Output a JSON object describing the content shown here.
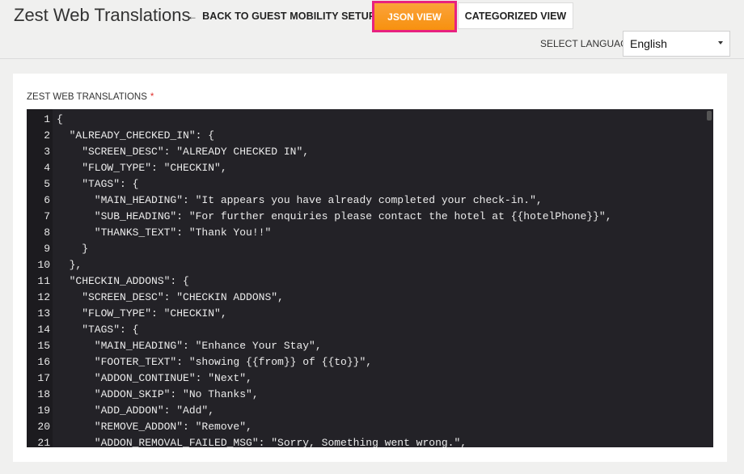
{
  "header": {
    "title": "Zest Web Translations",
    "back_label": "BACK TO GUEST MOBILITY SETUP",
    "json_view_label": "JSON VIEW",
    "categorized_view_label": "CATEGORIZED VIEW",
    "language_label": "SELECT LANGUAGE",
    "language_value": "English"
  },
  "form": {
    "field_label": "ZEST WEB TRANSLATIONS",
    "required_marker": "*"
  },
  "editor": {
    "lines": [
      {
        "n": "1",
        "text": "{"
      },
      {
        "n": "2",
        "text": "  \"ALREADY_CHECKED_IN\": {"
      },
      {
        "n": "3",
        "text": "    \"SCREEN_DESC\": \"ALREADY CHECKED IN\","
      },
      {
        "n": "4",
        "text": "    \"FLOW_TYPE\": \"CHECKIN\","
      },
      {
        "n": "5",
        "text": "    \"TAGS\": {"
      },
      {
        "n": "6",
        "text": "      \"MAIN_HEADING\": \"It appears you have already completed your check-in.\","
      },
      {
        "n": "7",
        "text": "      \"SUB_HEADING\": \"For further enquiries please contact the hotel at {{hotelPhone}}\","
      },
      {
        "n": "8",
        "text": "      \"THANKS_TEXT\": \"Thank You!!\""
      },
      {
        "n": "9",
        "text": "    }"
      },
      {
        "n": "10",
        "text": "  },"
      },
      {
        "n": "11",
        "text": "  \"CHECKIN_ADDONS\": {"
      },
      {
        "n": "12",
        "text": "    \"SCREEN_DESC\": \"CHECKIN ADDONS\","
      },
      {
        "n": "13",
        "text": "    \"FLOW_TYPE\": \"CHECKIN\","
      },
      {
        "n": "14",
        "text": "    \"TAGS\": {"
      },
      {
        "n": "15",
        "text": "      \"MAIN_HEADING\": \"Enhance Your Stay\","
      },
      {
        "n": "16",
        "text": "      \"FOOTER_TEXT\": \"showing {{from}} of {{to}}\","
      },
      {
        "n": "17",
        "text": "      \"ADDON_CONTINUE\": \"Next\","
      },
      {
        "n": "18",
        "text": "      \"ADDON_SKIP\": \"No Thanks\","
      },
      {
        "n": "19",
        "text": "      \"ADD_ADDON\": \"Add\","
      },
      {
        "n": "20",
        "text": "      \"REMOVE_ADDON\": \"Remove\","
      },
      {
        "n": "21",
        "text": "      \"ADDON_REMOVAL_FAILED_MSG\": \"Sorry, Something went wrong.\","
      }
    ]
  }
}
